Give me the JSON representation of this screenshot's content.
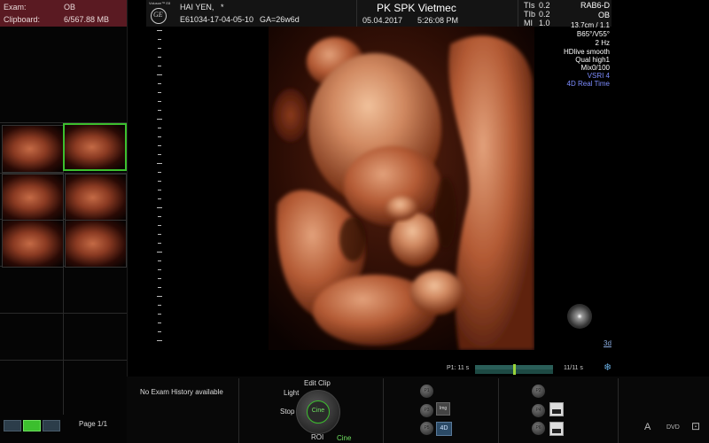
{
  "left_panel": {
    "exam_label": "Exam:",
    "exam_value": "OB",
    "clipboard_label": "Clipboard:",
    "clipboard_value": "6/567.88 MB",
    "page_text": "Page 1/1"
  },
  "header": {
    "logo_text": "Voluson™ E8",
    "patient_name": "HAI YEN,",
    "patient_marker": "*",
    "exam_id": "E61034-17-04-05-10",
    "gestational_age": "GA=26w6d",
    "clinic": "PK SPK Vietmec",
    "date": "05.04.2017",
    "time": "5:26:08 PM",
    "tis_label": "TIs",
    "tis_value": "0.2",
    "tib_label": "TIb",
    "tib_value": "0.2",
    "mi_label": "MI",
    "mi_value": "1.0"
  },
  "probe_info": {
    "probe": "RAB6-D",
    "mode": "OB",
    "depth": "13.7cm / 1.1",
    "angles": "B65°/V55°",
    "freq": "2 Hz",
    "render": "HDlive smooth",
    "quality": "Qual high1",
    "mix": "Mix0/100",
    "vsri": "VSRI 4",
    "realtime": "4D Real Time"
  },
  "cine": {
    "p1_label": "P1: 11 s",
    "frames": "11/11 s",
    "progress": 0.5
  },
  "history": {
    "text": "No Exam History available"
  },
  "control_wheel": {
    "edit_clip": "Edit Clip",
    "light": "Light",
    "stop": "Stop",
    "center": "Cine",
    "roi": "ROI",
    "cine": "Cine"
  },
  "buttons": {
    "p1": "P1",
    "p2": "P2",
    "p3": "P3",
    "p4": "P4",
    "p5": "P5",
    "p6": "P6",
    "img_label": "Img",
    "fourd_label": "4D",
    "scale_3d": "3d",
    "font_a": "A",
    "dvd": "DVD"
  },
  "colors": {
    "accent_green": "#3cbf2e",
    "exam_header": "#5a1a22",
    "info_blue": "#7d8cff"
  }
}
